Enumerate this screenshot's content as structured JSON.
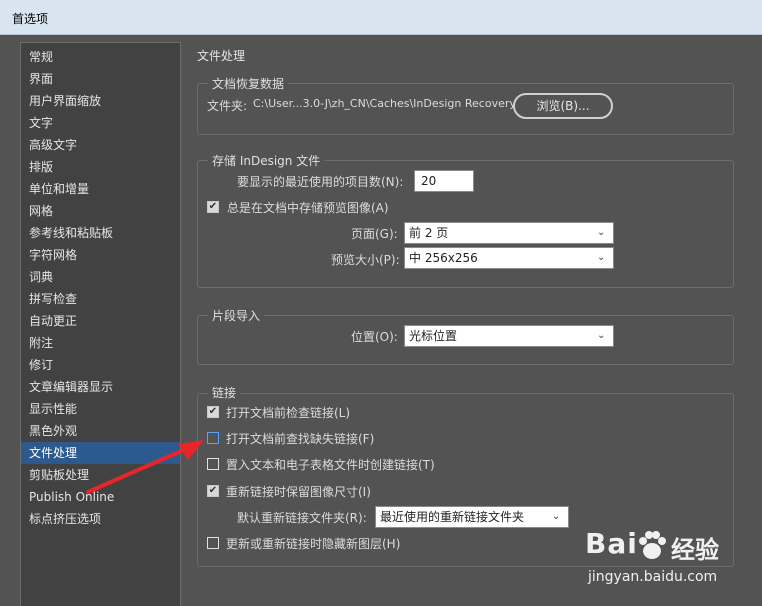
{
  "window": {
    "title": "首选项"
  },
  "sidebar": {
    "items": [
      {
        "label": "常规"
      },
      {
        "label": "界面"
      },
      {
        "label": "用户界面缩放"
      },
      {
        "label": "文字"
      },
      {
        "label": "高级文字"
      },
      {
        "label": "排版"
      },
      {
        "label": "单位和增量"
      },
      {
        "label": "网格"
      },
      {
        "label": "参考线和粘贴板"
      },
      {
        "label": "字符网格"
      },
      {
        "label": "词典"
      },
      {
        "label": "拼写检查"
      },
      {
        "label": "自动更正"
      },
      {
        "label": "附注"
      },
      {
        "label": "修订"
      },
      {
        "label": "文章编辑器显示"
      },
      {
        "label": "显示性能"
      },
      {
        "label": "黑色外观"
      },
      {
        "label": "文件处理",
        "selected": true
      },
      {
        "label": "剪贴板处理"
      },
      {
        "label": "Publish Online"
      },
      {
        "label": "标点挤压选项"
      }
    ]
  },
  "main": {
    "section_title": "文件处理",
    "recovery": {
      "title": "文档恢复数据",
      "folder_label": "文件夹:",
      "folder_path": "C:\\User...3.0-J\\zh_CN\\Caches\\InDesign Recovery",
      "browse_label": "浏览(B)..."
    },
    "storage": {
      "title": "存储 InDesign 文件",
      "recent_label": "要显示的最近使用的项目数(N):",
      "recent_value": "20",
      "preview_checkbox_label": "总是在文档中存储预览图像(A)",
      "preview_checked": true,
      "pages_label": "页面(G):",
      "pages_value": "前 2 页",
      "preview_size_label": "预览大小(P):",
      "preview_size_value": "中 256x256"
    },
    "snippet": {
      "title": "片段导入",
      "position_label": "位置(O):",
      "position_value": "光标位置"
    },
    "links": {
      "title": "链接",
      "check_links_label": "打开文档前检查链接(L)",
      "check_links_checked": true,
      "find_missing_label": "打开文档前查找缺失链接(F)",
      "find_missing_checked": false,
      "create_links_label": "置入文本和电子表格文件时创建链接(T)",
      "create_links_checked": false,
      "preserve_dims_label": "重新链接时保留图像尺寸(I)",
      "preserve_dims_checked": true,
      "default_folder_label": "默认重新链接文件夹(R):",
      "default_folder_value": "最近使用的重新链接文件夹",
      "hide_layers_label": "更新或重新链接时隐藏新图层(H)",
      "hide_layers_checked": false
    }
  },
  "watermark": {
    "brand": "Bai",
    "brand_tail": "经验",
    "url": "jingyan.baidu.com"
  },
  "colors": {
    "annotation_arrow": "#e8262a",
    "selection": "#2d5a8e"
  }
}
